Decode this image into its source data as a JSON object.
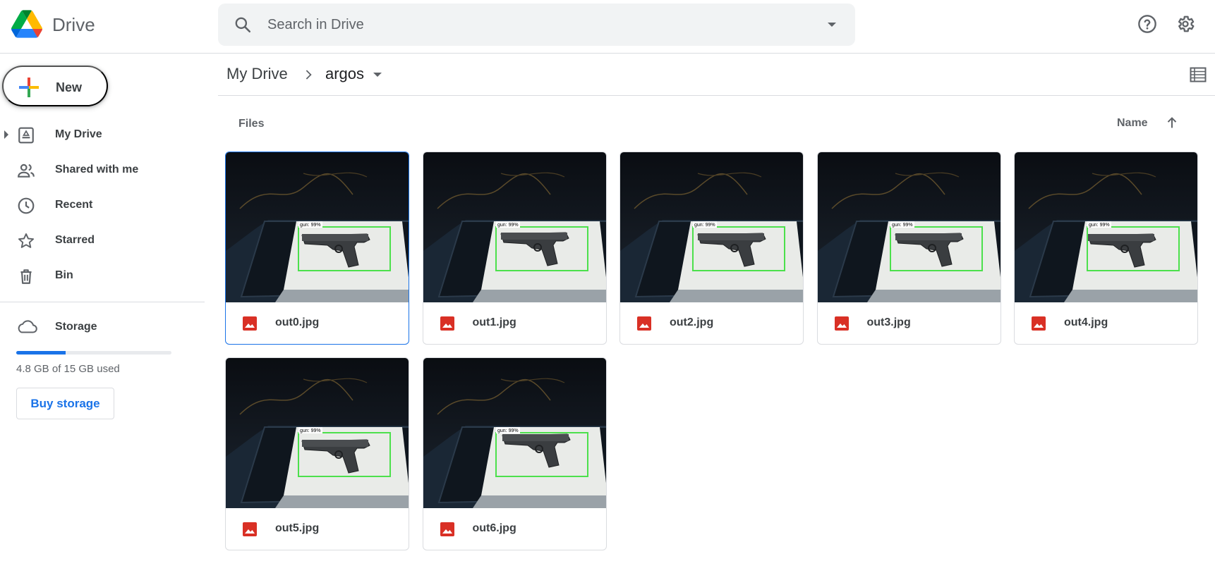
{
  "header": {
    "app_name": "Drive",
    "logo_icon": "google-drive-logo",
    "search": {
      "placeholder": "Search in Drive",
      "value": ""
    },
    "icons": [
      "search-icon",
      "search-options-icon",
      "help-icon",
      "gear-icon"
    ]
  },
  "sidebar": {
    "new_label": "New",
    "items": [
      {
        "label": "My Drive",
        "icon": "my-drive-icon",
        "expandable": true
      },
      {
        "label": "Shared with me",
        "icon": "shared-people-icon"
      },
      {
        "label": "Recent",
        "icon": "clock-icon"
      },
      {
        "label": "Starred",
        "icon": "star-icon"
      },
      {
        "label": "Bin",
        "icon": "trash-icon"
      }
    ],
    "storage": {
      "label": "Storage",
      "used_text": "4.8 GB of 15 GB used",
      "used_fraction": 0.32,
      "buy_label": "Buy storage"
    }
  },
  "breadcrumb": {
    "root": "My Drive",
    "current": "argos"
  },
  "main": {
    "section_label": "Files",
    "sort_label": "Name",
    "sort_direction": "ascending",
    "files": [
      {
        "name": "out0.jpg",
        "overlay_label": "gun: 99%",
        "selected": true
      },
      {
        "name": "out1.jpg",
        "overlay_label": "gun: 99%"
      },
      {
        "name": "out2.jpg",
        "overlay_label": "gun: 99%"
      },
      {
        "name": "out3.jpg",
        "overlay_label": "gun: 99%"
      },
      {
        "name": "out4.jpg",
        "overlay_label": "gun: 99%"
      },
      {
        "name": "out5.jpg",
        "overlay_label": "gun: 99%"
      },
      {
        "name": "out6.jpg",
        "overlay_label": "gun: 99%"
      }
    ]
  },
  "colors": {
    "accent": "#1a73e8",
    "image_icon": "#d93025",
    "detection_box": "#4ce04c"
  }
}
